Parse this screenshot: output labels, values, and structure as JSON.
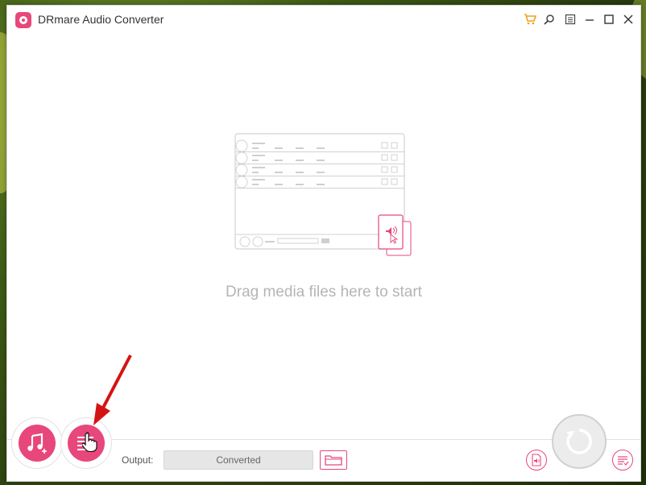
{
  "window": {
    "title": "DRmare Audio Converter"
  },
  "titlebar_icons": [
    "cart-icon",
    "search-icon",
    "menu-icon",
    "minimize-icon",
    "maximize-icon",
    "close-icon"
  ],
  "main": {
    "drag_hint": "Drag media files here to start"
  },
  "bottom": {
    "output_label": "Output:",
    "output_value": "Converted"
  },
  "colors": {
    "accent": "#e8477c",
    "hint_text": "#b5b5b5"
  }
}
